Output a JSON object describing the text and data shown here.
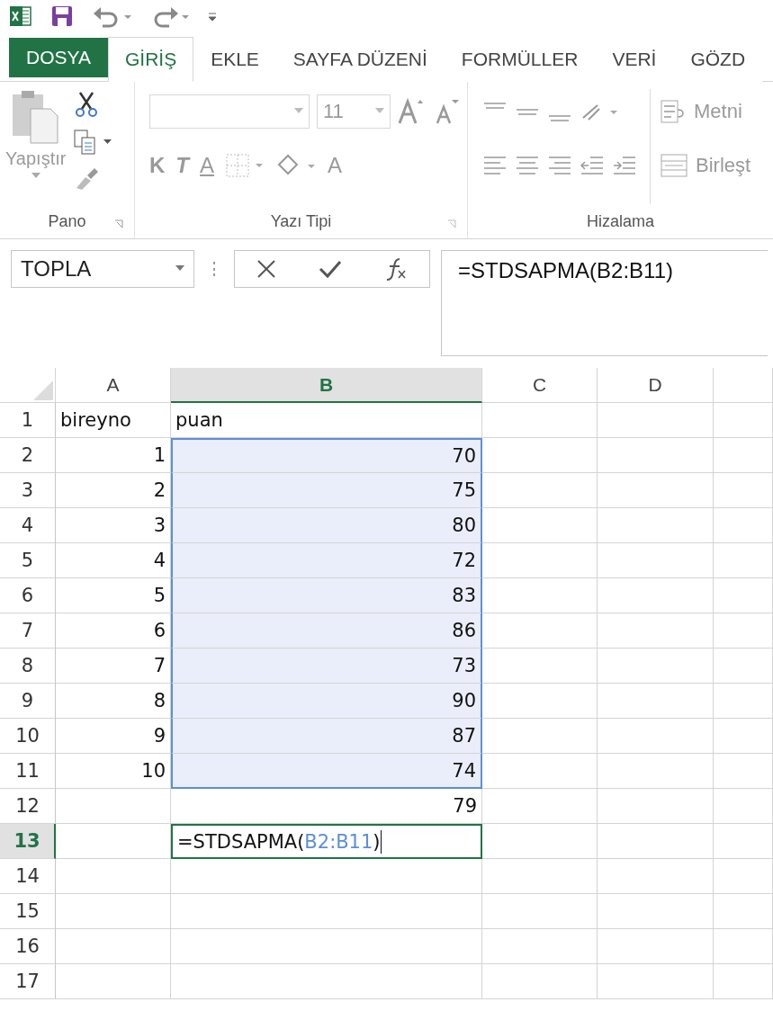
{
  "tabs": [
    {
      "label": "DOSYA",
      "kind": "file",
      "selected": false
    },
    {
      "label": "GİRİŞ",
      "kind": "tab",
      "selected": true
    },
    {
      "label": "EKLE",
      "kind": "tab",
      "selected": false
    },
    {
      "label": "SAYFA DÜZENİ",
      "kind": "tab",
      "selected": false
    },
    {
      "label": "FORMÜLLER",
      "kind": "tab",
      "selected": false
    },
    {
      "label": "VERİ",
      "kind": "tab",
      "selected": false
    },
    {
      "label": "GÖZD",
      "kind": "tab",
      "selected": false
    }
  ],
  "ribbon": {
    "clipboard": {
      "paste_label": "Yapıştır",
      "group": "Pano"
    },
    "font": {
      "size": "11",
      "bold": "K",
      "italic": "T",
      "underline": "A",
      "font_color": "A",
      "group": "Yazı Tipi"
    },
    "alignment": {
      "wrap": "Metni",
      "merge": "Birleşt",
      "group": "Hizalama"
    }
  },
  "formula_bar": {
    "name_box": "TOPLA",
    "formula": "=STDSAPMA(B2:B11)"
  },
  "columns": [
    {
      "label": "A",
      "selected": false
    },
    {
      "label": "B",
      "selected": true
    },
    {
      "label": "C",
      "selected": false
    },
    {
      "label": "D",
      "selected": false
    }
  ],
  "rows": [
    {
      "number": "1",
      "selected": false,
      "cells": [
        {
          "text": "bireyno",
          "kind": "text",
          "in_range": false
        },
        {
          "text": "puan",
          "kind": "text",
          "in_range": false
        }
      ]
    },
    {
      "number": "2",
      "selected": false,
      "cells": [
        {
          "text": "1",
          "kind": "number",
          "in_range": false
        },
        {
          "text": "70",
          "kind": "number",
          "in_range": true
        }
      ]
    },
    {
      "number": "3",
      "selected": false,
      "cells": [
        {
          "text": "2",
          "kind": "number",
          "in_range": false
        },
        {
          "text": "75",
          "kind": "number",
          "in_range": true
        }
      ]
    },
    {
      "number": "4",
      "selected": false,
      "cells": [
        {
          "text": "3",
          "kind": "number",
          "in_range": false
        },
        {
          "text": "80",
          "kind": "number",
          "in_range": true
        }
      ]
    },
    {
      "number": "5",
      "selected": false,
      "cells": [
        {
          "text": "4",
          "kind": "number",
          "in_range": false
        },
        {
          "text": "72",
          "kind": "number",
          "in_range": true
        }
      ]
    },
    {
      "number": "6",
      "selected": false,
      "cells": [
        {
          "text": "5",
          "kind": "number",
          "in_range": false
        },
        {
          "text": "83",
          "kind": "number",
          "in_range": true
        }
      ]
    },
    {
      "number": "7",
      "selected": false,
      "cells": [
        {
          "text": "6",
          "kind": "number",
          "in_range": false
        },
        {
          "text": "86",
          "kind": "number",
          "in_range": true
        }
      ]
    },
    {
      "number": "8",
      "selected": false,
      "cells": [
        {
          "text": "7",
          "kind": "number",
          "in_range": false
        },
        {
          "text": "73",
          "kind": "number",
          "in_range": true
        }
      ]
    },
    {
      "number": "9",
      "selected": false,
      "cells": [
        {
          "text": "8",
          "kind": "number",
          "in_range": false
        },
        {
          "text": "90",
          "kind": "number",
          "in_range": true
        }
      ]
    },
    {
      "number": "10",
      "selected": false,
      "cells": [
        {
          "text": "9",
          "kind": "number",
          "in_range": false
        },
        {
          "text": "87",
          "kind": "number",
          "in_range": true
        }
      ]
    },
    {
      "number": "11",
      "selected": false,
      "cells": [
        {
          "text": "10",
          "kind": "number",
          "in_range": false
        },
        {
          "text": "74",
          "kind": "number",
          "in_range": true
        }
      ]
    },
    {
      "number": "12",
      "selected": false,
      "cells": [
        {
          "kind": "empty"
        },
        {
          "text": "79",
          "kind": "number",
          "in_range": false
        }
      ]
    },
    {
      "number": "13",
      "selected": true,
      "cells": [
        {
          "kind": "empty"
        },
        {
          "kind": "editing",
          "in_range": false,
          "parts": [
            {
              "text": "=STDSAPMA(",
              "ref": false
            },
            {
              "text": "B2:B11",
              "ref": true
            },
            {
              "text": ")",
              "ref": false
            }
          ]
        }
      ]
    },
    {
      "number": "14",
      "selected": false,
      "cells": []
    },
    {
      "number": "15",
      "selected": false,
      "cells": []
    },
    {
      "number": "16",
      "selected": false,
      "cells": []
    },
    {
      "number": "17",
      "selected": false,
      "cells": []
    }
  ]
}
